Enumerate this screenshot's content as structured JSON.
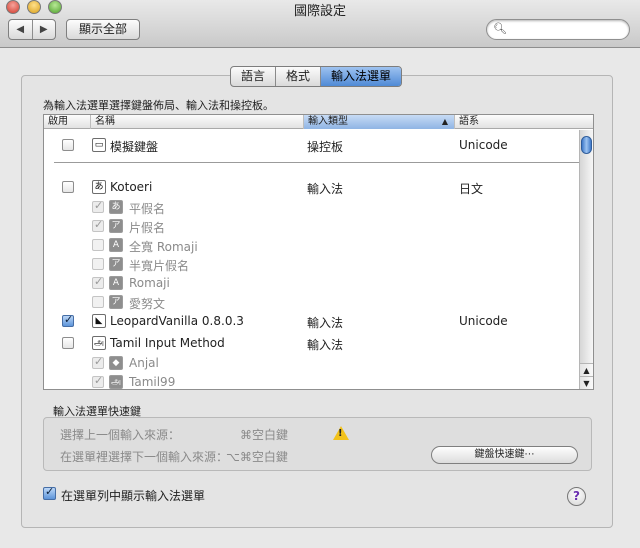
{
  "window": {
    "title": "國際設定"
  },
  "toolbar": {
    "back_label": "◀",
    "forward_label": "▶",
    "show_all_label": "顯示全部",
    "search_placeholder": ""
  },
  "tabs": [
    {
      "label": "語言"
    },
    {
      "label": "格式"
    },
    {
      "label": "輸入法選單"
    }
  ],
  "description": "為輸入法選單選擇鍵盤佈局、輸入法和操控板。",
  "table": {
    "columns": [
      "啟用",
      "名稱",
      "輸入類型",
      "語系"
    ],
    "sort_indicator": "▲",
    "rows": [
      {
        "checked": false,
        "dim": false,
        "icon": "keyboard-viewer-icon",
        "glyph": "▭",
        "name": "模擬鍵盤",
        "type": "操控板",
        "lang": "Unicode"
      },
      {
        "checked": false,
        "dim": false,
        "icon": "kotoeri-icon",
        "glyph": "あ",
        "name": "Kotoeri",
        "type": "輸入法",
        "lang": "日文"
      },
      {
        "checked": true,
        "dim": true,
        "icon": "hiragana-icon",
        "glyph": "あ",
        "name": "平假名",
        "type": "",
        "lang": ""
      },
      {
        "checked": true,
        "dim": true,
        "icon": "katakana-icon",
        "glyph": "ア",
        "name": "片假名",
        "type": "",
        "lang": ""
      },
      {
        "checked": false,
        "dim": true,
        "icon": "fullwidth-romaji-icon",
        "glyph": "A",
        "name": "全寬 Romaji",
        "type": "",
        "lang": ""
      },
      {
        "checked": false,
        "dim": true,
        "icon": "halfwidth-katakana-icon",
        "glyph": "ア",
        "name": "半寬片假名",
        "type": "",
        "lang": ""
      },
      {
        "checked": true,
        "dim": true,
        "icon": "romaji-icon",
        "glyph": "A",
        "name": "Romaji",
        "type": "",
        "lang": ""
      },
      {
        "checked": false,
        "dim": true,
        "icon": "ainu-icon",
        "glyph": "ア",
        "name": "愛努文",
        "type": "",
        "lang": ""
      },
      {
        "checked": true,
        "dim": false,
        "icon": "leopardvanilla-icon",
        "glyph": "◣",
        "name": "LeopardVanilla 0.8.0.3",
        "type": "輸入法",
        "lang": "Unicode"
      },
      {
        "checked": false,
        "dim": false,
        "icon": "tamil-icon",
        "glyph": "அ",
        "name": "Tamil Input Method",
        "type": "輸入法",
        "lang": ""
      },
      {
        "checked": true,
        "dim": true,
        "icon": "anjal-icon",
        "glyph": "◆",
        "name": "Anjal",
        "type": "",
        "lang": ""
      },
      {
        "checked": true,
        "dim": true,
        "icon": "tamil99-icon",
        "glyph": "அ",
        "name": "Tamil99",
        "type": "",
        "lang": ""
      }
    ]
  },
  "shortcuts": {
    "title": "輸入法選單快速鍵",
    "prev_label": "選擇上一個輸入來源：",
    "prev_key": "⌘空白鍵",
    "next_label": "在選單裡選擇下一個輸入來源：",
    "next_key": "⌥⌘空白鍵",
    "button_label": "鍵盤快速鍵⋯"
  },
  "footer": {
    "show_menu_checked": true,
    "show_menu_label": "在選單列中顯示輸入法選單",
    "help_label": "?"
  },
  "colors": {
    "accent": "#4f8ad6",
    "warning": "#f2c21b",
    "help": "#6a2fb0"
  }
}
